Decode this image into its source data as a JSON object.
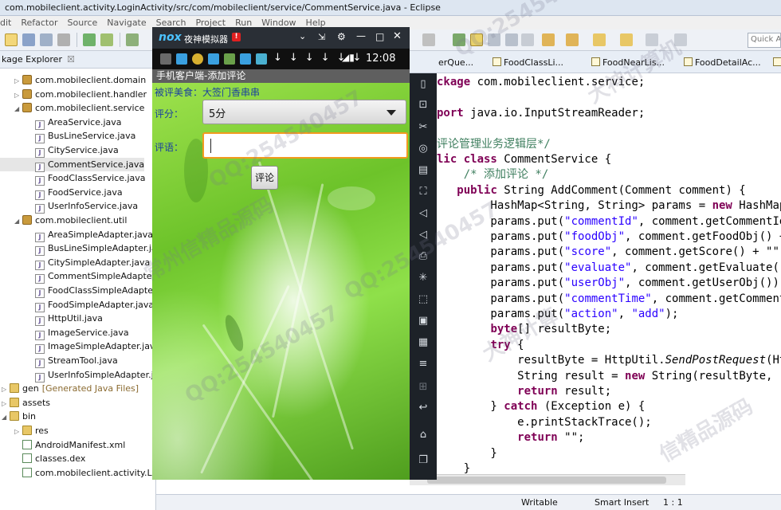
{
  "eclipse": {
    "window_title": "com.mobileclient.activity.LoginActivity/src/com/mobileclient/service/CommentService.java - Eclipse",
    "menu": [
      "dit",
      "Refactor",
      "Source",
      "Navigate",
      "Search",
      "Project",
      "Run",
      "Window",
      "Help"
    ],
    "quick_access": "Quick A",
    "package_explorer": {
      "tab_label": "kage Explorer",
      "close": "☒",
      "rows": [
        {
          "label": "com.mobileclient.domain",
          "kind": "pkg",
          "indent": 1
        },
        {
          "label": "com.mobileclient.handler",
          "kind": "pkg",
          "indent": 1
        },
        {
          "label": "com.mobileclient.service",
          "kind": "pkg",
          "indent": 1,
          "expanded": true
        },
        {
          "label": "AreaService.java",
          "kind": "file",
          "indent": 2
        },
        {
          "label": "BusLineService.java",
          "kind": "file",
          "indent": 2
        },
        {
          "label": "CityService.java",
          "kind": "file",
          "indent": 2
        },
        {
          "label": "CommentService.java",
          "kind": "file",
          "indent": 2,
          "selected": true
        },
        {
          "label": "FoodClassService.java",
          "kind": "file",
          "indent": 2
        },
        {
          "label": "FoodService.java",
          "kind": "file",
          "indent": 2
        },
        {
          "label": "UserInfoService.java",
          "kind": "file",
          "indent": 2
        },
        {
          "label": "com.mobileclient.util",
          "kind": "pkg",
          "indent": 1,
          "expanded": true
        },
        {
          "label": "AreaSimpleAdapter.java",
          "kind": "file",
          "indent": 2
        },
        {
          "label": "BusLineSimpleAdapter.java",
          "kind": "file",
          "indent": 2
        },
        {
          "label": "CitySimpleAdapter.java",
          "kind": "file",
          "indent": 2
        },
        {
          "label": "CommentSimpleAdapter.java",
          "kind": "file",
          "indent": 2
        },
        {
          "label": "FoodClassSimpleAdapter.java",
          "kind": "file",
          "indent": 2
        },
        {
          "label": "FoodSimpleAdapter.java",
          "kind": "file",
          "indent": 2
        },
        {
          "label": "HttpUtil.java",
          "kind": "file",
          "indent": 2
        },
        {
          "label": "ImageService.java",
          "kind": "file",
          "indent": 2
        },
        {
          "label": "ImageSimpleAdapter.java",
          "kind": "file",
          "indent": 2
        },
        {
          "label": "StreamTool.java",
          "kind": "file",
          "indent": 2
        },
        {
          "label": "UserInfoSimpleAdapter.java",
          "kind": "file",
          "indent": 2
        },
        {
          "label": "gen",
          "suffix": "[Generated Java Files]",
          "kind": "fold",
          "indent": 0
        },
        {
          "label": "assets",
          "kind": "fold",
          "indent": 0
        },
        {
          "label": "bin",
          "kind": "fold",
          "indent": 0,
          "expanded": true
        },
        {
          "label": "res",
          "kind": "fold",
          "indent": 1
        },
        {
          "label": "AndroidManifest.xml",
          "kind": "xml",
          "indent": 1
        },
        {
          "label": "classes.dex",
          "kind": "xml",
          "indent": 1
        },
        {
          "label": "com.mobileclient.activity.Login",
          "kind": "xml",
          "indent": 1
        }
      ]
    },
    "editor_tabs": [
      "erQue...",
      "FoodClassLi...",
      "FoodNearLis...",
      "FoodDetailAc...",
      "Co"
    ],
    "code_lines": [
      [
        {
          "t": "ckage",
          "c": "kw"
        },
        {
          "t": " com.mobileclient.service;"
        }
      ],
      [],
      [
        {
          "t": "port",
          "c": "kw"
        },
        {
          "t": " java.io.InputStreamReader;"
        }
      ],
      [],
      [
        {
          "t": "评论管理业务逻辑层*/",
          "c": "cm"
        }
      ],
      [
        {
          "t": "lic class",
          "c": "kw"
        },
        {
          "t": " CommentService {"
        }
      ],
      [
        {
          "t": "    /* 添加评论 */",
          "c": "cm"
        }
      ],
      [
        {
          "t": "   "
        },
        {
          "t": "public",
          "c": "kw"
        },
        {
          "t": " String AddComment(Comment comment) {"
        }
      ],
      [
        {
          "t": "        HashMap<String, String> params = "
        },
        {
          "t": "new",
          "c": "kw"
        },
        {
          "t": " HashMap"
        }
      ],
      [
        {
          "t": "        params.put("
        },
        {
          "t": "\"commentId\"",
          "c": "str"
        },
        {
          "t": ", comment.getCommentId"
        }
      ],
      [
        {
          "t": "        params.put("
        },
        {
          "t": "\"foodObj\"",
          "c": "str"
        },
        {
          "t": ", comment.getFoodObj() +"
        }
      ],
      [
        {
          "t": "        params.put("
        },
        {
          "t": "\"score\"",
          "c": "str"
        },
        {
          "t": ", comment.getScore() + \"\")"
        }
      ],
      [
        {
          "t": "        params.put("
        },
        {
          "t": "\"evaluate\"",
          "c": "str"
        },
        {
          "t": ", comment.getEvaluate()"
        }
      ],
      [
        {
          "t": "        params.put("
        },
        {
          "t": "\"userObj\"",
          "c": "str"
        },
        {
          "t": ", comment.getUserObj());"
        }
      ],
      [
        {
          "t": "        params.put("
        },
        {
          "t": "\"commentTime\"",
          "c": "str"
        },
        {
          "t": ", comment.getComment"
        }
      ],
      [
        {
          "t": "        params.put("
        },
        {
          "t": "\"action\"",
          "c": "str"
        },
        {
          "t": ", "
        },
        {
          "t": "\"add\"",
          "c": "str"
        },
        {
          "t": ");"
        }
      ],
      [
        {
          "t": "        "
        },
        {
          "t": "byte",
          "c": "kw"
        },
        {
          "t": "[] resultByte;"
        }
      ],
      [
        {
          "t": "        "
        },
        {
          "t": "try",
          "c": "kw"
        },
        {
          "t": " {"
        }
      ],
      [
        {
          "t": "            resultByte = HttpUtil."
        },
        {
          "t": "SendPostRequest",
          "c": "it"
        },
        {
          "t": "(Ht"
        }
      ],
      [
        {
          "t": "            String result = "
        },
        {
          "t": "new",
          "c": "kw"
        },
        {
          "t": " String(resultByte, \""
        }
      ],
      [
        {
          "t": "            "
        },
        {
          "t": "return",
          "c": "kw"
        },
        {
          "t": " result;"
        }
      ],
      [
        {
          "t": "        } "
        },
        {
          "t": "catch",
          "c": "kw"
        },
        {
          "t": " (Exception e) {"
        }
      ],
      [
        {
          "t": "            e.printStackTrace();"
        }
      ],
      [
        {
          "t": "            "
        },
        {
          "t": "return",
          "c": "kw"
        },
        {
          "t": " \"\";"
        }
      ],
      [
        {
          "t": "        }"
        }
      ],
      [
        {
          "t": "    }"
        }
      ]
    ],
    "status": {
      "writable": "Writable",
      "insert_mode": "Smart Insert",
      "position": "1 : 1"
    }
  },
  "emulator": {
    "logo": "nox",
    "title": "夜神模拟器",
    "badge": "!",
    "clock": "12:08",
    "app_title": "手机客户端-添加评论",
    "food_label": "被评美食：大签门香串串",
    "score_label": "评分：",
    "score_value": "5分",
    "comment_label": "评语：",
    "comment_value": "",
    "submit_label": "评论"
  },
  "watermarks": [
    "QQ:25454045",
    "大神计算机",
    "QQ:254540457",
    "常州信精品源码",
    "QQ:254540457",
    "大神计算",
    "QQ:254540457",
    "信精品源码"
  ],
  "colors": {
    "keyword": "#7f0055",
    "string": "#2a00ff",
    "comment": "#3f7f5f",
    "accent_orange": "#f29a1e",
    "emulator_dark": "#2a2f36"
  }
}
